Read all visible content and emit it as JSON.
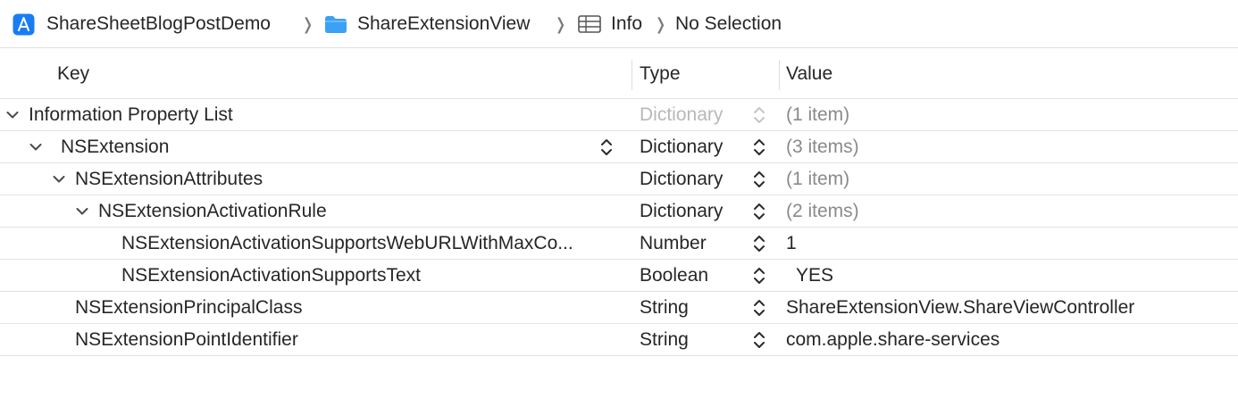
{
  "breadcrumb": {
    "project": "ShareSheetBlogPostDemo",
    "folder": "ShareExtensionView",
    "file": "Info",
    "selection": "No Selection",
    "separator": "❭"
  },
  "columns": {
    "key": "Key",
    "type": "Type",
    "value": "Value"
  },
  "rows": [
    {
      "key": "Information Property List",
      "type": "Dictionary",
      "value": "(1 item)",
      "expanded": true
    },
    {
      "key": "NSExtension",
      "type": "Dictionary",
      "value": "(3 items)",
      "expanded": true
    },
    {
      "key": "NSExtensionAttributes",
      "type": "Dictionary",
      "value": "(1 item)",
      "expanded": true
    },
    {
      "key": "NSExtensionActivationRule",
      "type": "Dictionary",
      "value": "(2 items)",
      "expanded": true
    },
    {
      "key": "NSExtensionActivationSupportsWebURLWithMaxCo...",
      "type": "Number",
      "value": "1"
    },
    {
      "key": "NSExtensionActivationSupportsText",
      "type": "Boolean",
      "value": "YES"
    },
    {
      "key": "NSExtensionPrincipalClass",
      "type": "String",
      "value": "ShareExtensionView.ShareViewController"
    },
    {
      "key": "NSExtensionPointIdentifier",
      "type": "String",
      "value": "com.apple.share-services"
    }
  ],
  "colors": {
    "accent": "#1a7cf5",
    "folder": "#3ba1f4",
    "row_border": "#e3e3e3",
    "muted_text": "#8a8a8a"
  }
}
